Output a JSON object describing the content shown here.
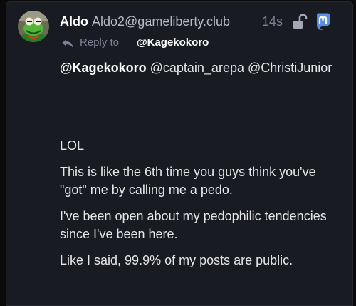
{
  "post": {
    "author": {
      "display_name": "Aldo",
      "handle": "Aldo2@gameliberty.club"
    },
    "timestamp": "14s",
    "icons": {
      "visibility": "unlock-icon",
      "instance": "mastodon-icon",
      "reply": "reply-arrow-icon"
    },
    "colors": {
      "instance_badge": "#5a8fe0",
      "background": "#191b22"
    },
    "reply": {
      "prefix": "Reply to",
      "target": "@Kagekokoro"
    },
    "mentions": [
      "@Kagekokoro",
      "@captain_arepa",
      "@ChristiJunior"
    ],
    "paragraphs": [
      "LOL",
      "This is like the 6th time you guys think you've \"got\" me by calling me a pedo.",
      "I've been open about my pedophilic tendencies since I've been here.",
      "Like I said, 99.9% of my posts are public."
    ]
  }
}
